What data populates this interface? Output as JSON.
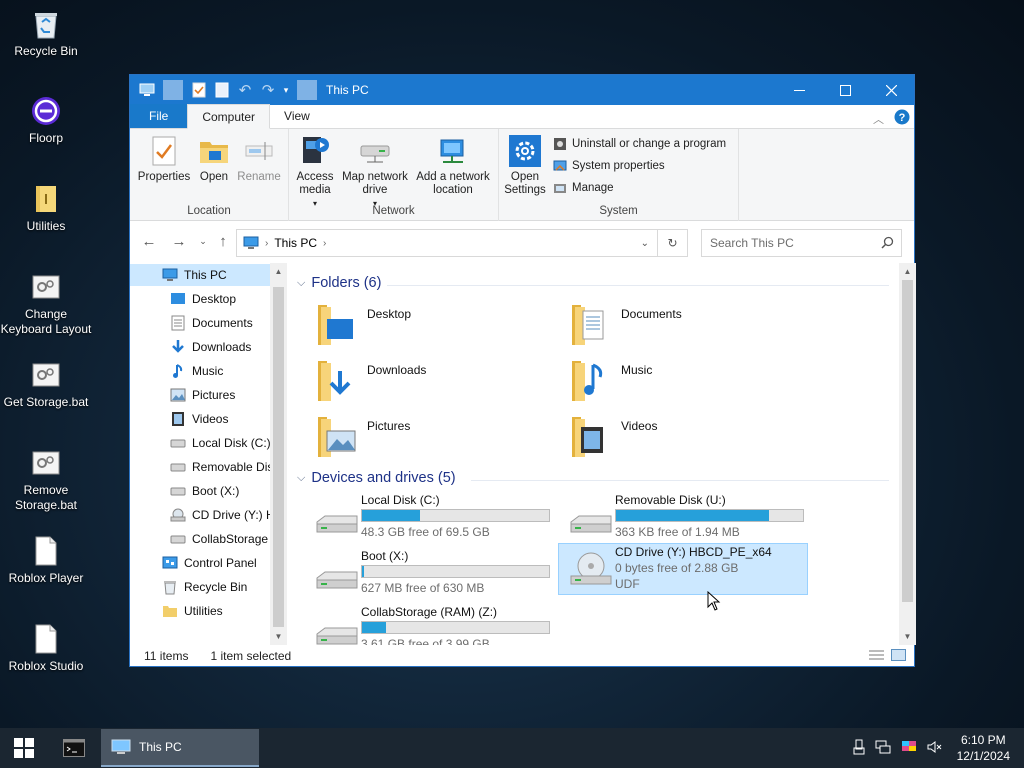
{
  "desktop": {
    "icons": [
      {
        "label": "Recycle Bin",
        "icon": "recycle-bin-icon"
      },
      {
        "label": "Floorp",
        "icon": "floorp-browser-icon"
      },
      {
        "label": "Utilities",
        "icon": "folder-icon"
      },
      {
        "label": "Change Keyboard Layout",
        "icon": "batch-file-icon"
      },
      {
        "label": "Get Storage.bat",
        "icon": "batch-file-icon"
      },
      {
        "label": "Remove Storage.bat",
        "icon": "batch-file-icon"
      },
      {
        "label": "Roblox Player",
        "icon": "document-icon"
      },
      {
        "label": "Roblox Studio",
        "icon": "document-icon"
      }
    ]
  },
  "window": {
    "title": "This PC",
    "accent_color": "#1c78cf",
    "tabs": {
      "file": "File",
      "computer": "Computer",
      "view": "View"
    },
    "ribbon": {
      "location": {
        "label": "Location",
        "properties": "Properties",
        "open": "Open",
        "rename": "Rename"
      },
      "network": {
        "label": "Network",
        "access_media": "Access media",
        "map_network_drive": "Map network drive",
        "add_network_location": "Add a network location"
      },
      "system": {
        "label": "System",
        "open_settings": "Open Settings",
        "uninstall": "Uninstall or change a program",
        "system_properties": "System properties",
        "manage": "Manage"
      }
    },
    "address": {
      "path": "This PC",
      "search_placeholder": "Search This PC"
    },
    "nav_pane": [
      {
        "label": "This PC",
        "icon": "computer-icon",
        "selected": true
      },
      {
        "label": "Desktop",
        "icon": "desktop-icon"
      },
      {
        "label": "Documents",
        "icon": "documents-icon"
      },
      {
        "label": "Downloads",
        "icon": "downloads-icon"
      },
      {
        "label": "Music",
        "icon": "music-icon"
      },
      {
        "label": "Pictures",
        "icon": "pictures-icon"
      },
      {
        "label": "Videos",
        "icon": "videos-icon"
      },
      {
        "label": "Local Disk (C:)",
        "icon": "drive-icon"
      },
      {
        "label": "Removable Dis",
        "icon": "drive-icon"
      },
      {
        "label": "Boot (X:)",
        "icon": "drive-icon"
      },
      {
        "label": "CD Drive (Y:) H",
        "icon": "cd-drive-icon"
      },
      {
        "label": "CollabStorage",
        "icon": "drive-icon"
      },
      {
        "label": "Control Panel",
        "icon": "control-panel-icon"
      },
      {
        "label": "Recycle Bin",
        "icon": "recycle-bin-icon"
      },
      {
        "label": "Utilities",
        "icon": "folder-icon"
      }
    ],
    "folders_group": "Folders (6)",
    "folders": [
      {
        "label": "Desktop",
        "icon": "desktop-folder-icon"
      },
      {
        "label": "Documents",
        "icon": "documents-folder-icon"
      },
      {
        "label": "Downloads",
        "icon": "downloads-folder-icon"
      },
      {
        "label": "Music",
        "icon": "music-folder-icon"
      },
      {
        "label": "Pictures",
        "icon": "pictures-folder-icon"
      },
      {
        "label": "Videos",
        "icon": "videos-folder-icon"
      }
    ],
    "drives_group": "Devices and drives (5)",
    "drives": [
      {
        "name": "Local Disk (C:)",
        "free": "48.3 GB free of 69.5 GB",
        "used_fraction": 0.31
      },
      {
        "name": "Removable Disk (U:)",
        "free": "363 KB free of 1.94 MB",
        "used_fraction": 0.82
      },
      {
        "name": "Boot (X:)",
        "free": "627 MB free of 630 MB",
        "used_fraction": 0.005
      },
      {
        "name": "CD Drive (Y:) HBCD_PE_x64",
        "free": "0 bytes free of 2.88 GB",
        "fs": "UDF",
        "selected": true
      },
      {
        "name": "CollabStorage (RAM) (Z:)",
        "free": "3.61 GB free of 3.99 GB",
        "used_fraction": 0.13
      }
    ],
    "status": {
      "items": "11 items",
      "selected": "1 item selected"
    }
  },
  "taskbar": {
    "active_app": "This PC",
    "time": "6:10 PM",
    "date": "12/1/2024"
  }
}
